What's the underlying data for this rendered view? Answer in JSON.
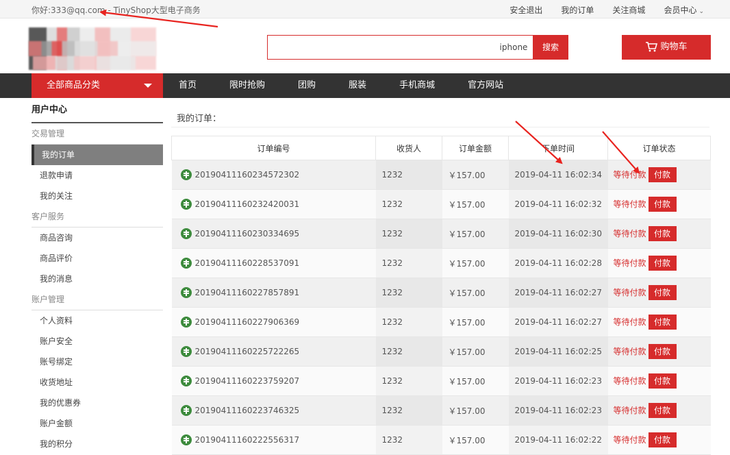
{
  "topbar": {
    "greeting": "你好:333@qq.com - TinyShop大型电子商务",
    "links": [
      "安全退出",
      "我的订单",
      "关注商城",
      "会员中心"
    ]
  },
  "header": {
    "search_value": "",
    "search_hint": "iphone",
    "search_button": "搜索",
    "cart_label": "购物车"
  },
  "nav": {
    "all_categories": "全部商品分类",
    "items": [
      "首页",
      "限时抢购",
      "团购",
      "服装",
      "手机商城",
      "官方网站"
    ]
  },
  "sidebar": {
    "title": "用户中心",
    "groups": [
      {
        "label": "交易管理",
        "items": [
          "我的订单",
          "退款申请",
          "我的关注"
        ]
      },
      {
        "label": "客户服务",
        "items": [
          "商品咨询",
          "商品评价",
          "我的消息"
        ]
      },
      {
        "label": "账户管理",
        "items": [
          "个人资料",
          "账户安全",
          "账号绑定",
          "收货地址",
          "我的优惠券",
          "账户金额",
          "我的积分"
        ]
      }
    ],
    "active_item": "我的订单"
  },
  "main": {
    "title": "我的订单：",
    "columns": [
      "订单编号",
      "收货人",
      "订单金额",
      "下单时间",
      "订单状态"
    ],
    "pay_label": "付款",
    "orders": [
      {
        "no": "20190411160234572302",
        "receiver": "1232",
        "amount": "￥157.00",
        "time": "2019-04-11 16:02:34",
        "status": "等待付款"
      },
      {
        "no": "20190411160232420031",
        "receiver": "1232",
        "amount": "￥157.00",
        "time": "2019-04-11 16:02:32",
        "status": "等待付款"
      },
      {
        "no": "20190411160230334695",
        "receiver": "1232",
        "amount": "￥157.00",
        "time": "2019-04-11 16:02:30",
        "status": "等待付款"
      },
      {
        "no": "20190411160228537091",
        "receiver": "1232",
        "amount": "￥157.00",
        "time": "2019-04-11 16:02:28",
        "status": "等待付款"
      },
      {
        "no": "20190411160227857891",
        "receiver": "1232",
        "amount": "￥157.00",
        "time": "2019-04-11 16:02:27",
        "status": "等待付款"
      },
      {
        "no": "20190411160227906369",
        "receiver": "1232",
        "amount": "￥157.00",
        "time": "2019-04-11 16:02:27",
        "status": "等待付款"
      },
      {
        "no": "20190411160225722265",
        "receiver": "1232",
        "amount": "￥157.00",
        "time": "2019-04-11 16:02:25",
        "status": "等待付款"
      },
      {
        "no": "20190411160223759207",
        "receiver": "1232",
        "amount": "￥157.00",
        "time": "2019-04-11 16:02:23",
        "status": "等待付款"
      },
      {
        "no": "20190411160223746325",
        "receiver": "1232",
        "amount": "￥157.00",
        "time": "2019-04-11 16:02:23",
        "status": "等待付款"
      },
      {
        "no": "20190411160222556317",
        "receiver": "1232",
        "amount": "￥157.00",
        "time": "2019-04-11 16:02:22",
        "status": "等待付款"
      }
    ]
  },
  "colors": {
    "accent": "#d62b2b",
    "nav_bg": "#333333",
    "annotation": "#e8231f"
  }
}
